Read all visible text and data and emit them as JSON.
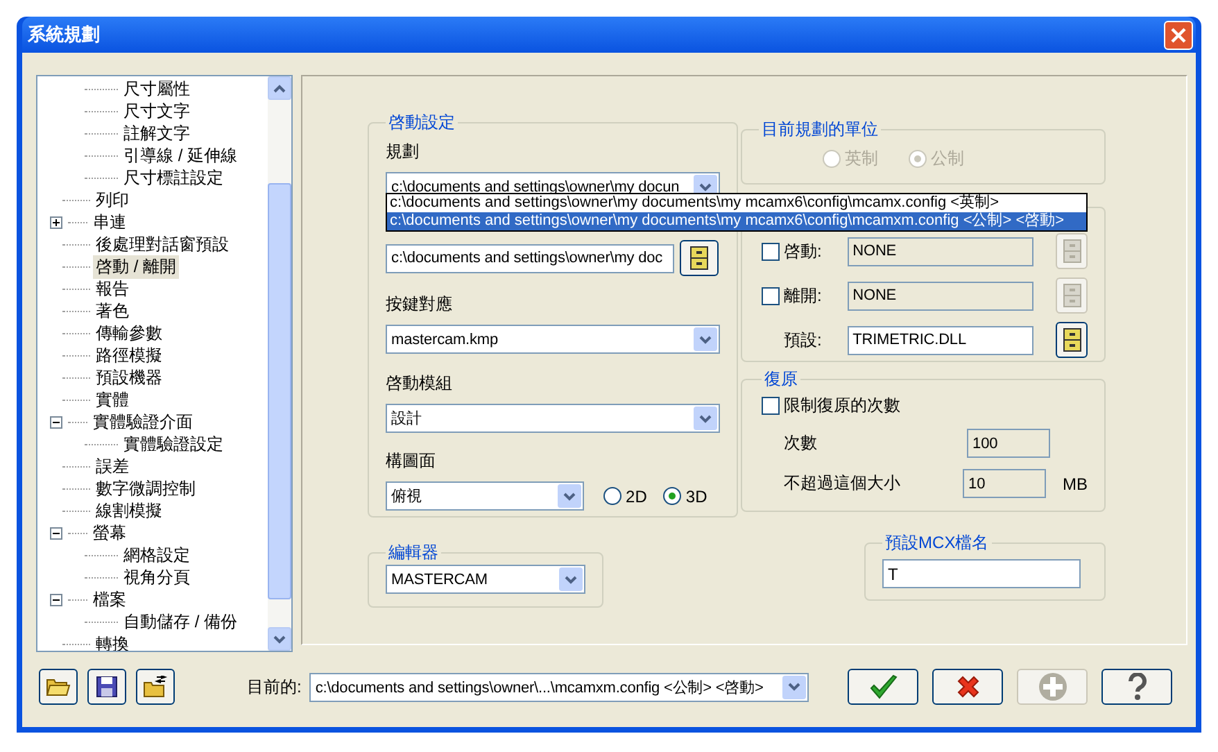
{
  "window": {
    "title": "系統規劃"
  },
  "tree": {
    "partial_children": [
      {
        "label": "尺寸屬性",
        "selected": false
      },
      {
        "label": "尺寸文字",
        "selected": false
      },
      {
        "label": "註解文字",
        "selected": false
      },
      {
        "label": "引導線 / 延伸線",
        "selected": false
      },
      {
        "label": "尺寸標註設定",
        "selected": false
      }
    ],
    "items": [
      {
        "label": "列印",
        "selected": false
      },
      {
        "label": "串連",
        "selected": false,
        "expanded": false
      },
      {
        "label": "後處理對話窗預設",
        "selected": false
      },
      {
        "label": "啓動 / 離開",
        "selected": true
      },
      {
        "label": "報告",
        "selected": false
      },
      {
        "label": "著色",
        "selected": false
      },
      {
        "label": "傳輸參數",
        "selected": false
      },
      {
        "label": "路徑模擬",
        "selected": false
      },
      {
        "label": "預設機器",
        "selected": false
      },
      {
        "label": "實體",
        "selected": false
      },
      {
        "label": "實體驗證介面",
        "selected": false,
        "expanded": true,
        "children": [
          {
            "label": "實體驗證設定",
            "selected": false
          }
        ]
      },
      {
        "label": "誤差",
        "selected": false
      },
      {
        "label": "數字微調控制",
        "selected": false
      },
      {
        "label": "線割模擬",
        "selected": false
      },
      {
        "label": "螢幕",
        "selected": false,
        "expanded": true,
        "children": [
          {
            "label": "網格設定",
            "selected": false
          },
          {
            "label": "視角分頁",
            "selected": false
          }
        ]
      },
      {
        "label": "檔案",
        "selected": false,
        "expanded": true,
        "children": [
          {
            "label": "自動儲存 / 備份",
            "selected": false
          }
        ]
      },
      {
        "label": "轉換",
        "selected": false
      }
    ]
  },
  "startup": {
    "title": "啓動設定",
    "config": {
      "label": "規劃",
      "value": "c:\\documents and settings\\owner\\my docun"
    },
    "path_field": {
      "value": "c:\\documents and settings\\owner\\my doc"
    },
    "keymap": {
      "label": "按鍵對應",
      "value": "mastercam.kmp"
    },
    "module": {
      "label": "啓動模組",
      "value": "設計"
    },
    "plane": {
      "label": "構圖面",
      "value": "俯視",
      "options": [
        {
          "label": "2D",
          "selected": false
        },
        {
          "label": "3D",
          "selected": true
        }
      ]
    }
  },
  "config_dropdown": {
    "options": [
      {
        "label": "c:\\documents and settings\\owner\\my documents\\my mcamx6\\config\\mcamx.config <英制>",
        "selected": false
      },
      {
        "label": "c:\\documents and settings\\owner\\my documents\\my mcamx6\\config\\mcamxm.config <公制> <啓動>",
        "selected": true
      }
    ]
  },
  "units": {
    "title": "目前規劃的單位",
    "disabled": true,
    "options": [
      {
        "label": "英制",
        "selected": false
      },
      {
        "label": "公制",
        "selected": true
      }
    ]
  },
  "addins": {
    "rows": [
      {
        "kind": "check",
        "label": "啓動:",
        "checked": false,
        "value": "NONE",
        "disabled": true
      },
      {
        "kind": "check",
        "label": "離開:",
        "checked": false,
        "value": "NONE",
        "disabled": true
      },
      {
        "kind": "plain",
        "label": "預設:",
        "value": "TRIMETRIC.DLL",
        "disabled": false
      }
    ]
  },
  "undo": {
    "title": "復原",
    "limit": {
      "label": "限制復原的次數",
      "checked": false
    },
    "fields": [
      {
        "label": "次數",
        "value": "100"
      },
      {
        "label": "不超過這個大小",
        "value": "10",
        "unit": "MB"
      }
    ]
  },
  "editor": {
    "title": "編輯器",
    "value": "MASTERCAM"
  },
  "default_mcx": {
    "title": "預設MCX檔名",
    "value": "T"
  },
  "footer": {
    "tools": [
      {
        "kind": "open"
      },
      {
        "kind": "save"
      },
      {
        "kind": "merge"
      }
    ],
    "current_label": "目前的:",
    "current_value": "c:\\documents and settings\\owner\\...\\mcamxm.config <公制> <啓動>",
    "buttons": [
      {
        "kind": "ok",
        "disabled": false
      },
      {
        "kind": "cancel",
        "disabled": false
      },
      {
        "kind": "add",
        "disabled": true
      },
      {
        "kind": "help",
        "disabled": false
      }
    ]
  }
}
